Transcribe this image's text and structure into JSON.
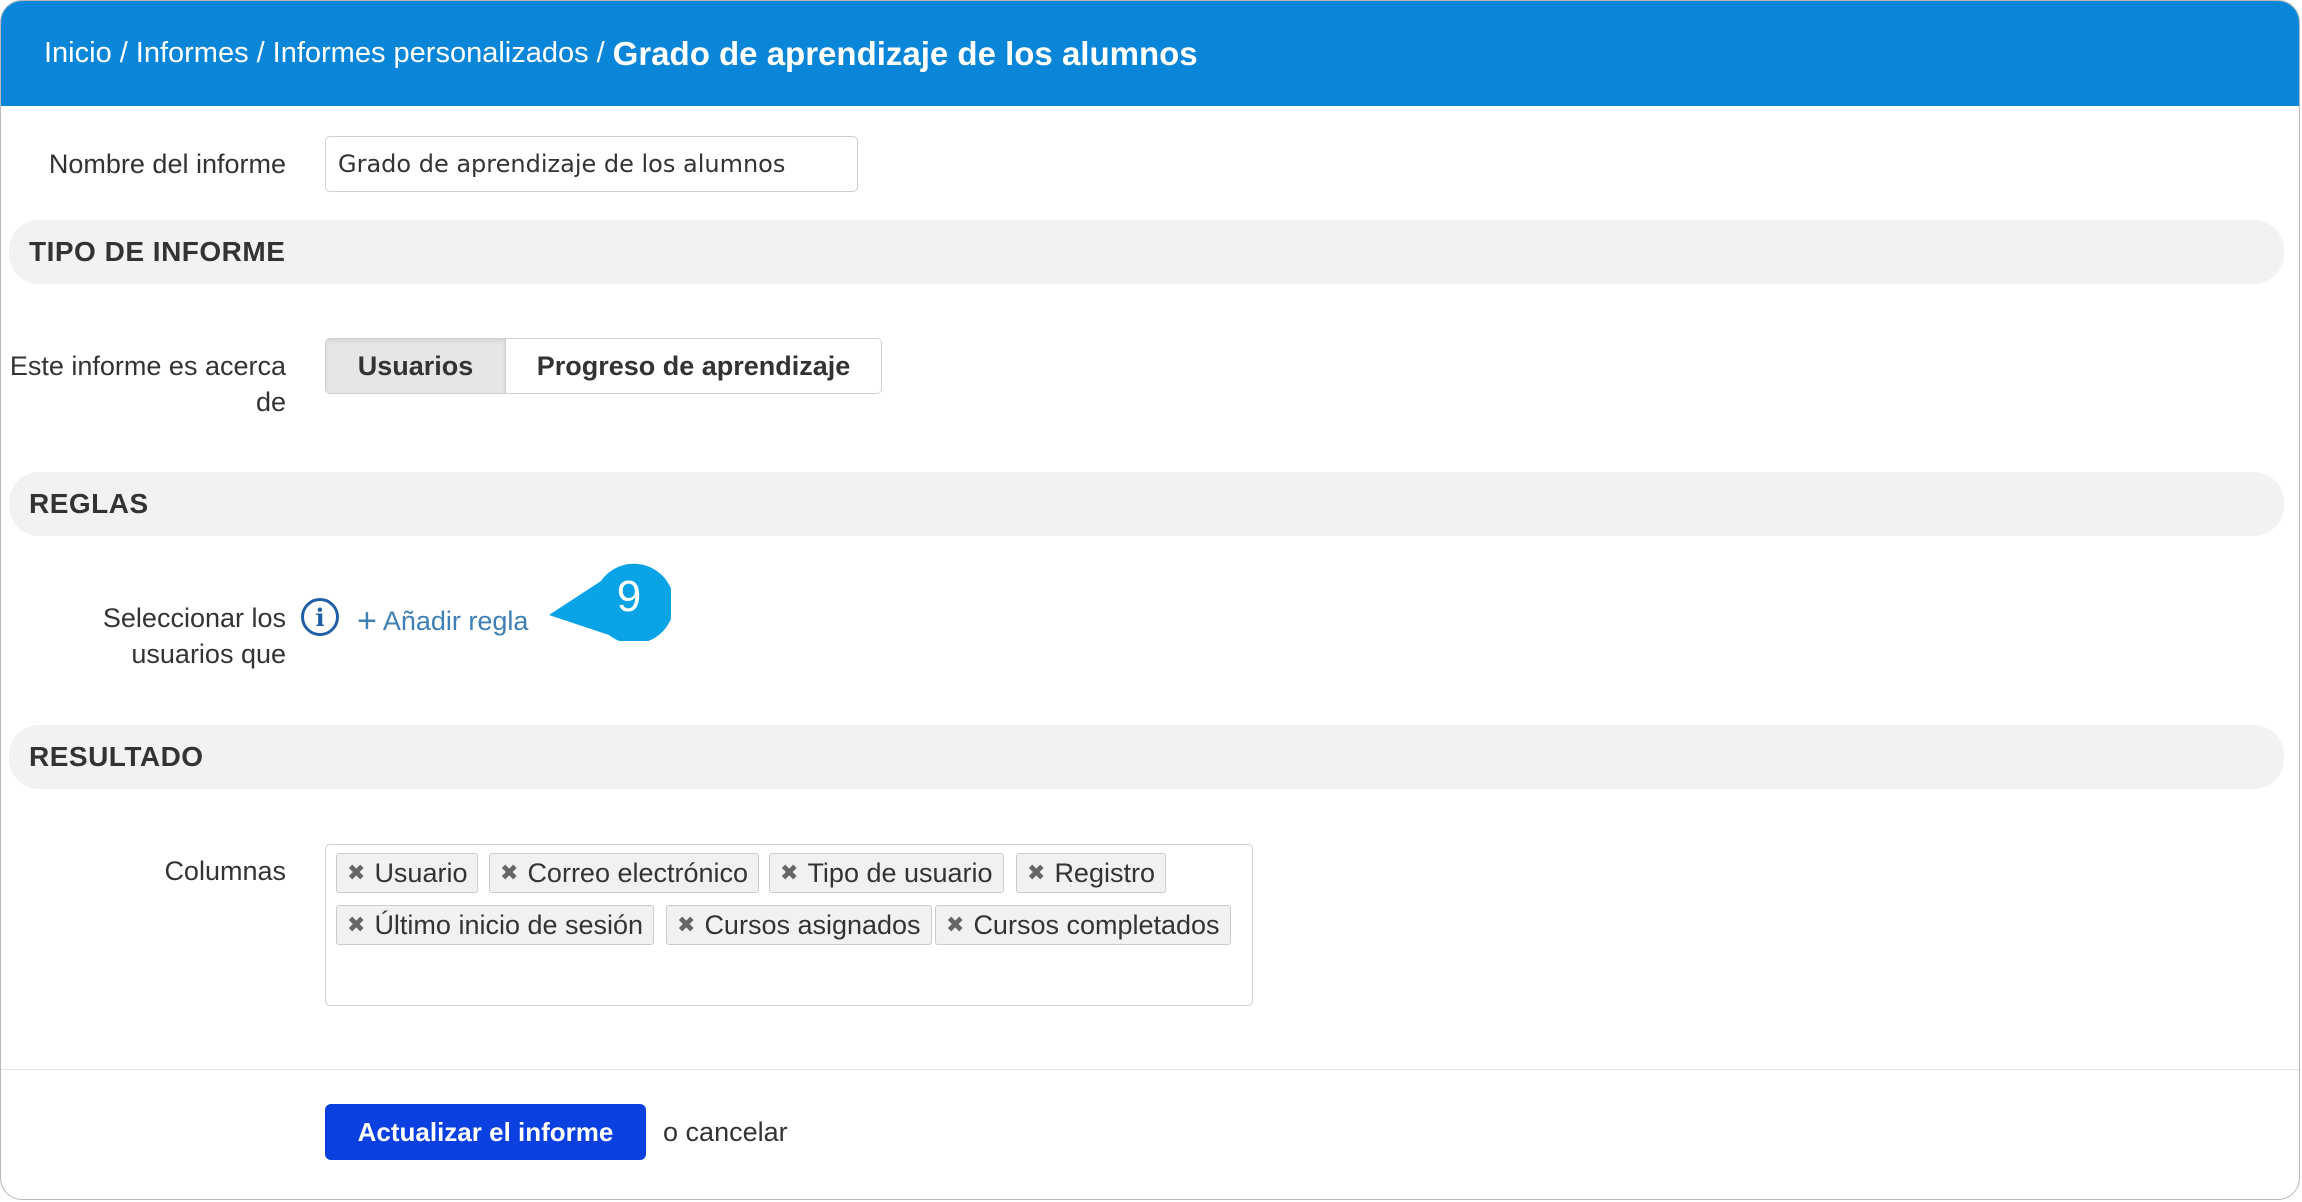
{
  "breadcrumb": {
    "items": [
      "Inicio",
      "Informes",
      "Informes personalizados"
    ],
    "separator": "/",
    "current": "Grado de aprendizaje de los alumnos"
  },
  "report_name": {
    "label": "Nombre del informe",
    "value": "Grado de aprendizaje de los alumnos"
  },
  "sections": {
    "type": "TIPO DE INFORME",
    "rules": "REGLAS",
    "result": "RESULTADO"
  },
  "report_type": {
    "label_line1": "Este informe es acerca",
    "label_line2": "de",
    "options": [
      "Usuarios",
      "Progreso de aprendizaje"
    ],
    "selected": "Usuarios"
  },
  "rules": {
    "label_line1": "Seleccionar los",
    "label_line2": "usuarios que",
    "add_rule": "Añadir regla",
    "icon": "info-icon"
  },
  "callout": {
    "number": "9",
    "color": "#0aa3e6"
  },
  "columns": {
    "label": "Columnas",
    "tags": [
      "Usuario",
      "Correo electrónico",
      "Tipo de usuario",
      "Registro",
      "Último inicio de sesión",
      "Cursos asignados",
      "Cursos completados"
    ]
  },
  "actions": {
    "submit": "Actualizar el informe",
    "cancel_prefix": "o",
    "cancel": "cancelar"
  },
  "colors": {
    "header": "#0a86d8",
    "primary_button": "#0a3fe0",
    "link": "#3f7fb5"
  }
}
